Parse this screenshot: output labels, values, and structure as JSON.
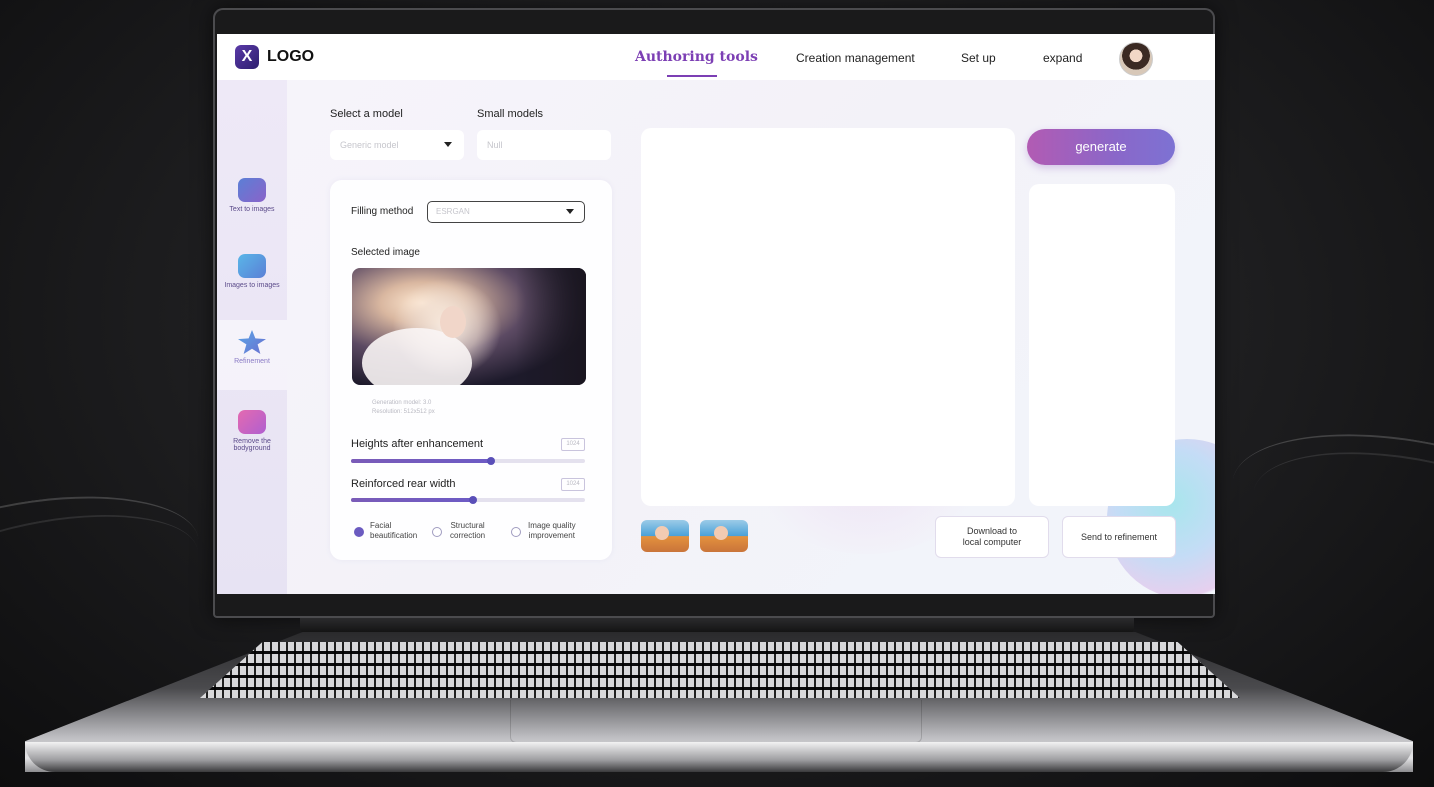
{
  "header": {
    "logo_mark": "X",
    "logo_text": "LOGO",
    "nav": [
      {
        "label": "Authoring tools",
        "active": true
      },
      {
        "label": "Creation management",
        "active": false
      },
      {
        "label": "Set up",
        "active": false
      },
      {
        "label": "expand",
        "active": false
      }
    ]
  },
  "sidebar": {
    "items": [
      {
        "label": "Text to images",
        "icon": "chat-image-icon",
        "active": false
      },
      {
        "label": "Images to images",
        "icon": "image-edit-icon",
        "active": false
      },
      {
        "label": "Refinement",
        "icon": "star-icon",
        "active": true
      },
      {
        "label": "Remove the bodyground",
        "icon": "eraser-image-icon",
        "active": false
      }
    ]
  },
  "model": {
    "select_label": "Select a model",
    "select_placeholder": "Generic model",
    "small_label": "Small models",
    "small_placeholder": "Null"
  },
  "panel": {
    "filling_label": "Filling method",
    "filling_value": "ESRGAN",
    "selected_image_label": "Selected image",
    "image_meta_1": "Generation model: 3.0",
    "image_meta_2": "Resolution: 512x512 px",
    "slider1_label": "Heights after enhancement",
    "slider1_value_box": "1024",
    "slider1_fraction": 0.6,
    "slider2_label": "Reinforced rear width",
    "slider2_value_box": "1024",
    "slider2_fraction": 0.52,
    "options": [
      {
        "label_1": "Facial",
        "label_2": "beautification",
        "checked": true
      },
      {
        "label_1": "Structural",
        "label_2": "correction",
        "checked": false
      },
      {
        "label_1": "Image quality",
        "label_2": "improvement",
        "checked": false
      }
    ]
  },
  "right": {
    "generate_label": "generate",
    "download_label_1": "Download to",
    "download_label_2": "local computer",
    "send_label": "Send to refinement"
  },
  "colors": {
    "accent": "#7c3fb4",
    "generate_gradient_start": "#b25bb3",
    "generate_gradient_end": "#7d72d3"
  }
}
